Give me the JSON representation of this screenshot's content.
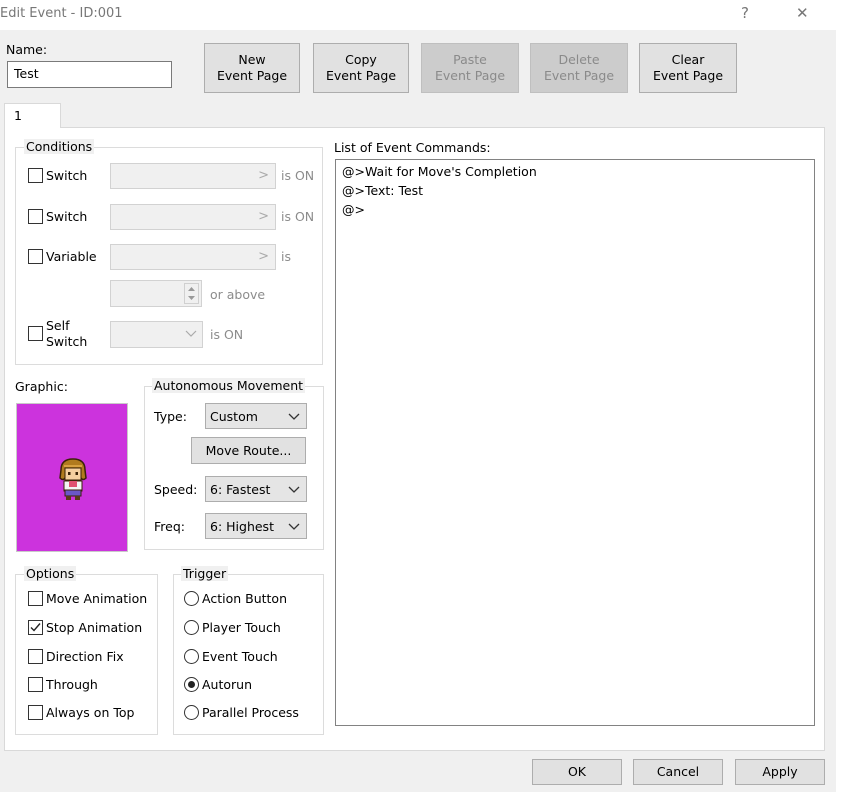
{
  "window": {
    "title": "Edit Event - ID:001",
    "help_glyph": "?",
    "close_glyph": "✕"
  },
  "name": {
    "label": "Name:",
    "value": "Test"
  },
  "toolbar": {
    "new_page": "New\nEvent Page",
    "copy_page": "Copy\nEvent Page",
    "paste_page": "Paste\nEvent Page",
    "delete_page": "Delete\nEvent Page",
    "clear_page": "Clear\nEvent Page"
  },
  "tabs": [
    {
      "label": "1"
    }
  ],
  "conditions": {
    "title": "Conditions",
    "switch1_label": "Switch",
    "switch1_suffix": "is ON",
    "switch2_label": "Switch",
    "switch2_suffix": "is ON",
    "variable_label": "Variable",
    "variable_suffix": "is",
    "variable_or_above": "or above",
    "self_switch_label_1": "Self",
    "self_switch_label_2": "Switch",
    "self_switch_suffix": "is ON",
    "selector_arrow": ">"
  },
  "graphic": {
    "label": "Graphic:",
    "background_color": "#cc33dd"
  },
  "autonomous_movement": {
    "title": "Autonomous Movement",
    "type_label": "Type:",
    "type_value": "Custom",
    "move_route_button": "Move Route...",
    "speed_label": "Speed:",
    "speed_value": "6: Fastest",
    "freq_label": "Freq:",
    "freq_value": "6: Highest"
  },
  "options": {
    "title": "Options",
    "items": [
      {
        "label": "Move Animation",
        "checked": false
      },
      {
        "label": "Stop Animation",
        "checked": true
      },
      {
        "label": "Direction Fix",
        "checked": false
      },
      {
        "label": "Through",
        "checked": false
      },
      {
        "label": "Always on Top",
        "checked": false
      }
    ]
  },
  "trigger": {
    "title": "Trigger",
    "items": [
      {
        "label": "Action Button",
        "selected": false
      },
      {
        "label": "Player Touch",
        "selected": false
      },
      {
        "label": "Event Touch",
        "selected": false
      },
      {
        "label": "Autorun",
        "selected": true
      },
      {
        "label": "Parallel Process",
        "selected": false
      }
    ]
  },
  "commands": {
    "title": "List of Event Commands:",
    "lines": [
      "@>Wait for Move's Completion",
      "@>Text: Test",
      "@>"
    ]
  },
  "footer": {
    "ok": "OK",
    "cancel": "Cancel",
    "apply": "Apply"
  }
}
